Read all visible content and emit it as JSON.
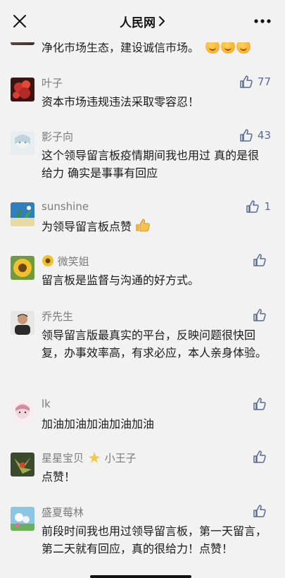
{
  "header": {
    "title": "人民网",
    "chevron": "chevron-right-icon",
    "close_icon": "close-icon",
    "more_icon": "more-icon"
  },
  "partial_comment": {
    "text": "净化市场生态，建设诚信市场。"
  },
  "comments": [
    {
      "name": "叶子",
      "text": "资本市场违规违法采取零容忍！",
      "likes": "77",
      "avatar_color": "#a9302c"
    },
    {
      "name": "影子向",
      "text": "这个领导留言板疫情期间我也用过 真的是很给力 确实是事事有回应",
      "likes": "43",
      "avatar_color": "#dfe8ee"
    },
    {
      "name": "sunshine",
      "text": "为领导留言板点赞",
      "likes": "1",
      "avatar_color": "#2f7fc0"
    },
    {
      "name": "微笑姐",
      "text": "留言板是监督与沟通的好方式。",
      "likes": "",
      "avatar_color": "#e8b22c"
    },
    {
      "name": "乔先生",
      "text": "领导留言版最真实的平台，反映问题很快回复，办事效率高，有求必应，本人亲身体验。",
      "likes": "",
      "avatar_color": "#333333"
    },
    {
      "name": "lk",
      "text": "加油加油加油加油加油",
      "likes": "",
      "avatar_color": "#f0dde4"
    },
    {
      "name": "星星宝贝",
      "name_suffix": "小王子",
      "text": "点赞！",
      "likes": "",
      "avatar_color": "#4f6a3a"
    },
    {
      "name": "盛夏莓林",
      "text": "前段时间我也用过领导留言板，第一天留言，第二天就有回应，真的很给力！点赞！",
      "likes": "",
      "avatar_color": "#7ab6d8"
    }
  ],
  "accent_color": "#576b95"
}
